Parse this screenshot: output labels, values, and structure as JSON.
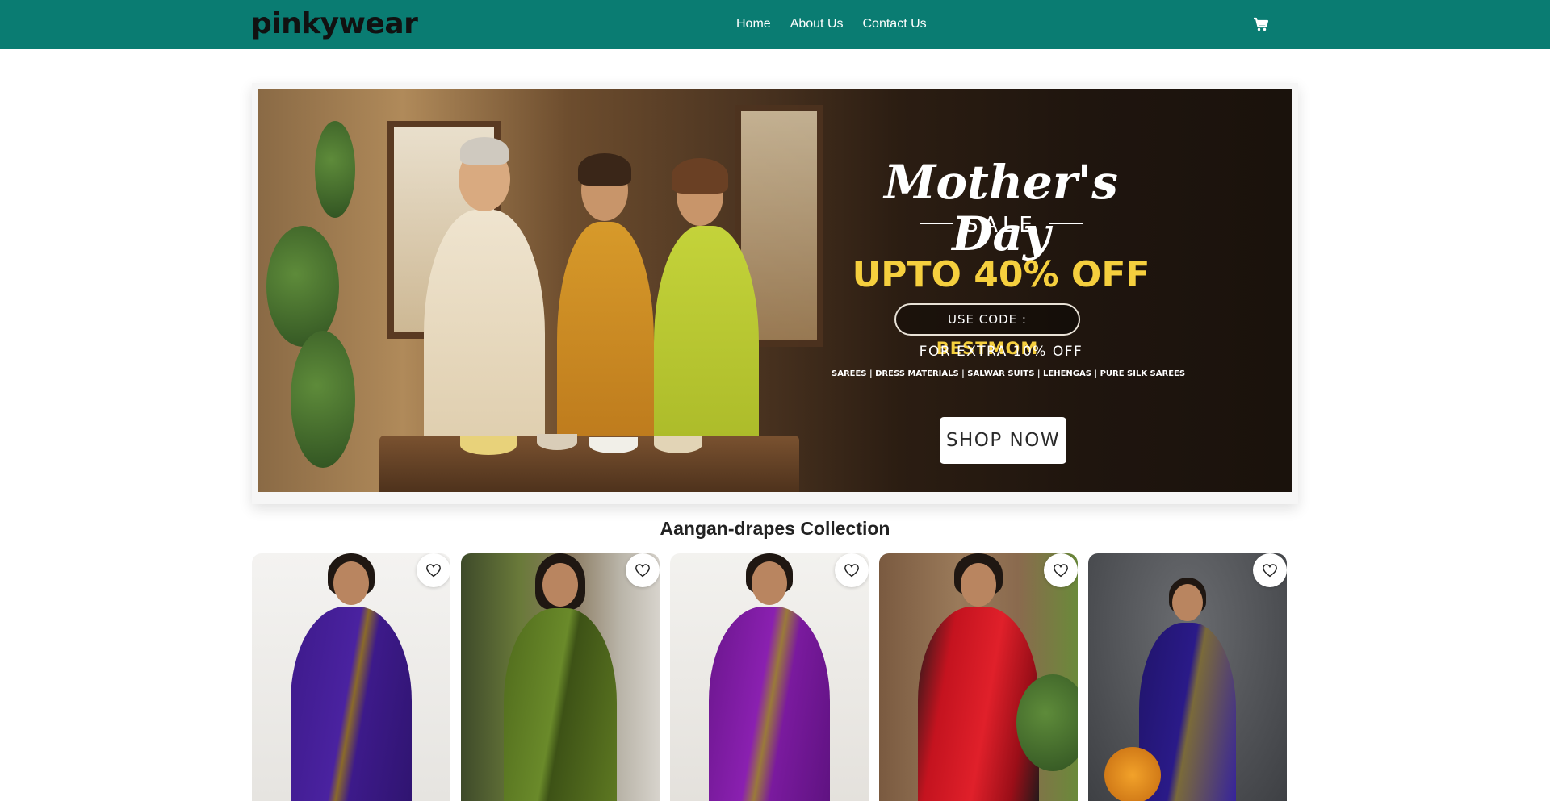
{
  "header": {
    "logo": "pinkywear",
    "nav": [
      "Home",
      "About Us",
      "Contact Us"
    ],
    "cart_icon": "shopping-cart-icon",
    "background_color": "#0a7c72"
  },
  "hero": {
    "title": "Mother's Day",
    "subtitle": "SALE",
    "offer": "UPTO 40% OFF",
    "code_label": "USE CODE :",
    "code": "BESTMOM",
    "extra": "FOR EXTRA 10% OFF",
    "categories": "SAREES | DRESS MATERIALS | SALWAR SUITS | LEHENGAS | PURE SILK SAREES",
    "cta": "SHOP NOW",
    "offer_color": "#f5cf3e"
  },
  "collection": {
    "title": "Aangan-drapes Collection",
    "products": [
      {
        "saree_color": "#3d1a8a",
        "border_color": "#8a6a2a",
        "background": "#eeece9",
        "wishlist_icon": "heart-outline-icon"
      },
      {
        "saree_color": "#5f7a22",
        "border_color": "#3d5216",
        "background": "#6d6150",
        "wishlist_icon": "heart-outline-icon"
      },
      {
        "saree_color": "#7a1a9e",
        "border_color": "#9a7a3a",
        "background": "#efedea",
        "wishlist_icon": "heart-outline-icon"
      },
      {
        "saree_color": "#c4131f",
        "border_color": "#1a1a1a",
        "background": "#8a6a4e",
        "wishlist_icon": "heart-outline-icon"
      },
      {
        "saree_color": "#2a1a88",
        "border_color": "#7a6a3a",
        "background": "#55575a",
        "wishlist_icon": "heart-outline-icon"
      }
    ]
  }
}
